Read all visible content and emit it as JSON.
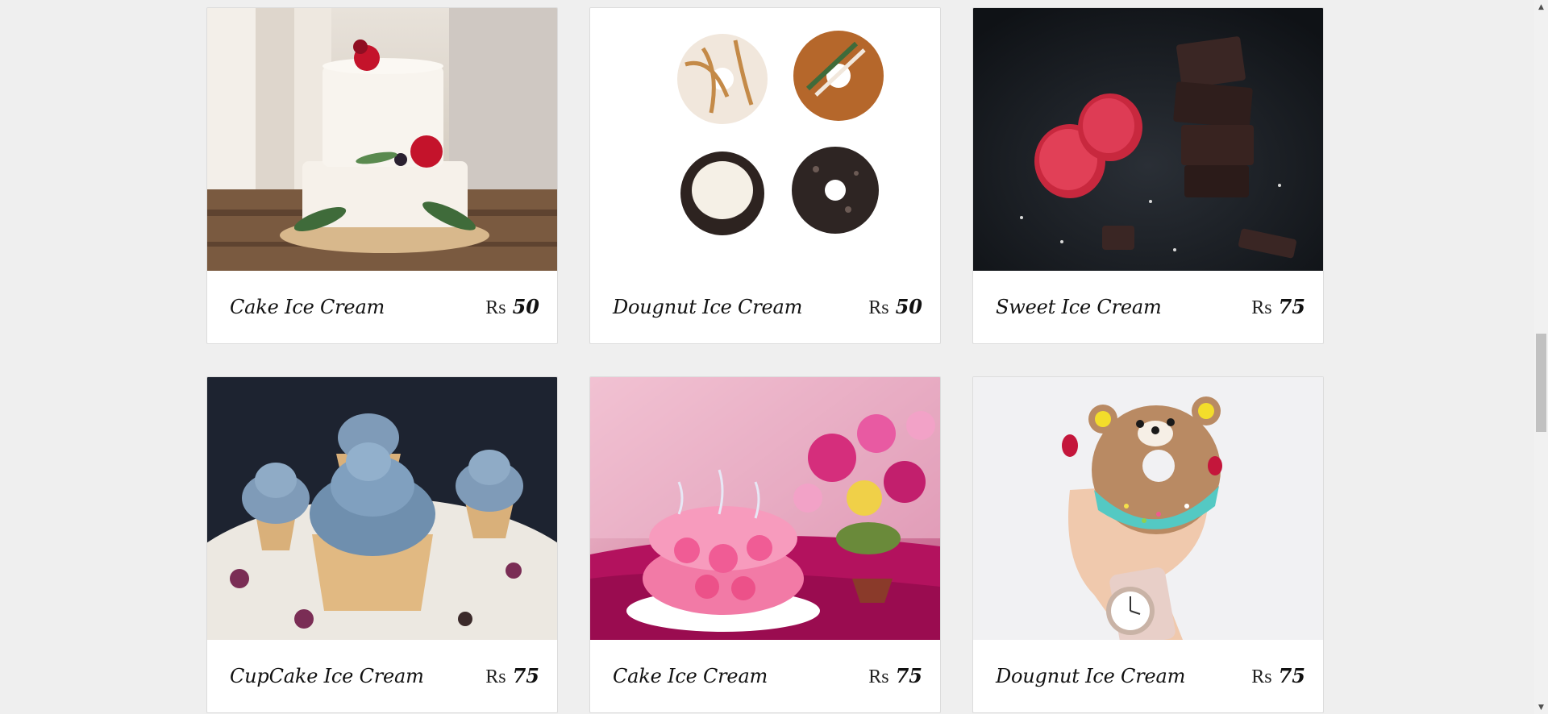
{
  "products": [
    {
      "name": "Cake Ice Cream",
      "currency": "Rs",
      "price": "50",
      "image_icon": "tiered-cake-image"
    },
    {
      "name": "Dougnut Ice Cream",
      "currency": "Rs",
      "price": "50",
      "image_icon": "donuts-image"
    },
    {
      "name": "Sweet Ice Cream",
      "currency": "Rs",
      "price": "75",
      "image_icon": "chocolate-raspberry-image"
    },
    {
      "name": "CupCake Ice Cream",
      "currency": "Rs",
      "price": "75",
      "image_icon": "cupcakes-image"
    },
    {
      "name": "Cake Ice Cream",
      "currency": "Rs",
      "price": "75",
      "image_icon": "pink-rose-cake-image"
    },
    {
      "name": "Dougnut Ice Cream",
      "currency": "Rs",
      "price": "75",
      "image_icon": "bear-donut-image"
    }
  ],
  "colors": {
    "page_background": "#efefef",
    "card_background": "#ffffff",
    "text": "#111111"
  }
}
